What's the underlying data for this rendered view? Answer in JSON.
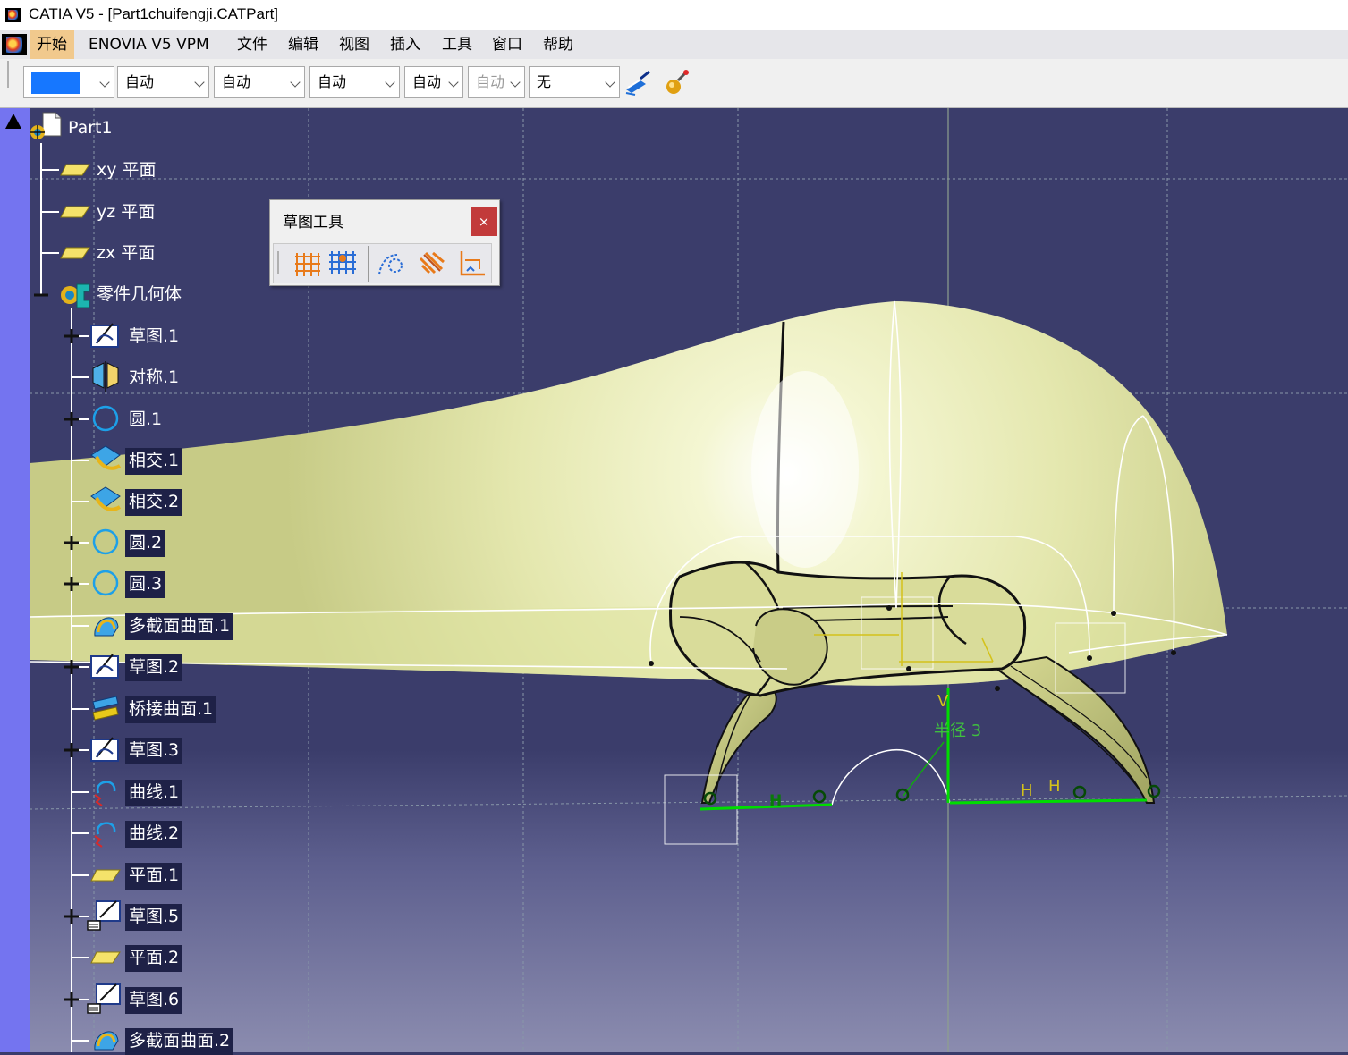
{
  "window": {
    "title": "CATIA V5 - [Part1chuifengji.CATPart]"
  },
  "menu": {
    "items": [
      {
        "label": "开始",
        "active": true
      },
      {
        "label": "ENOVIA V5 VPM"
      },
      {
        "label": "文件"
      },
      {
        "label": "编辑"
      },
      {
        "label": "视图"
      },
      {
        "label": "插入"
      },
      {
        "label": "工具"
      },
      {
        "label": "窗口"
      },
      {
        "label": "帮助"
      }
    ]
  },
  "toolbar": {
    "color_swatch": "#1677ff",
    "combo_1": "自动",
    "combo_2": "自动",
    "combo_3": "自动",
    "combo_4": "自动",
    "combo_5": "自动",
    "combo_6": "无",
    "icons": [
      "paintbrush-icon",
      "magic-wand-icon"
    ]
  },
  "palette": {
    "title": "草图工具",
    "close_label": "×",
    "icons": [
      "grid-icon",
      "snap-to-point-icon",
      "construction-element-icon",
      "geometric-constraints-icon",
      "dimensional-constraints-icon"
    ]
  },
  "tree": {
    "root": "Part1",
    "planes": [
      "xy 平面",
      "yz 平面",
      "zx 平面"
    ],
    "body": "零件几何体",
    "children": [
      {
        "label": "草图.1",
        "type": "sketch",
        "expand": true
      },
      {
        "label": "对称.1",
        "type": "symmetry"
      },
      {
        "label": "圆.1",
        "type": "circle",
        "expand": true
      },
      {
        "label": "相交.1",
        "type": "intersect",
        "selected": true
      },
      {
        "label": "相交.2",
        "type": "intersect",
        "selected": true
      },
      {
        "label": "圆.2",
        "type": "circle",
        "expand": true,
        "selected": true
      },
      {
        "label": "圆.3",
        "type": "circle",
        "expand": true,
        "selected": true
      },
      {
        "label": "多截面曲面.1",
        "type": "multisection",
        "selected": true
      },
      {
        "label": "草图.2",
        "type": "sketch",
        "expand": true,
        "selected": true
      },
      {
        "label": "桥接曲面.1",
        "type": "blend",
        "selected": true
      },
      {
        "label": "草图.3",
        "type": "sketch",
        "expand": true,
        "selected": true
      },
      {
        "label": "曲线.1",
        "type": "curve",
        "selected": true
      },
      {
        "label": "曲线.2",
        "type": "curve",
        "selected": true
      },
      {
        "label": "平面.1",
        "type": "plane",
        "selected": true
      },
      {
        "label": "草图.5",
        "type": "sketch2",
        "expand": true,
        "selected": true
      },
      {
        "label": "平面.2",
        "type": "plane",
        "selected": true
      },
      {
        "label": "草图.6",
        "type": "sketch2",
        "expand": true,
        "selected": true
      },
      {
        "label": "多截面曲面.2",
        "type": "multisection",
        "selected": true
      }
    ]
  },
  "viewport": {
    "constraint_labels": {
      "h1": "H",
      "h2": "H",
      "h3": "H",
      "v1": "V",
      "radius": "半径 3"
    },
    "surface_color": "#e9edb0",
    "grid_color": "#7f8fa0",
    "constraint_color": "#00dd00"
  }
}
